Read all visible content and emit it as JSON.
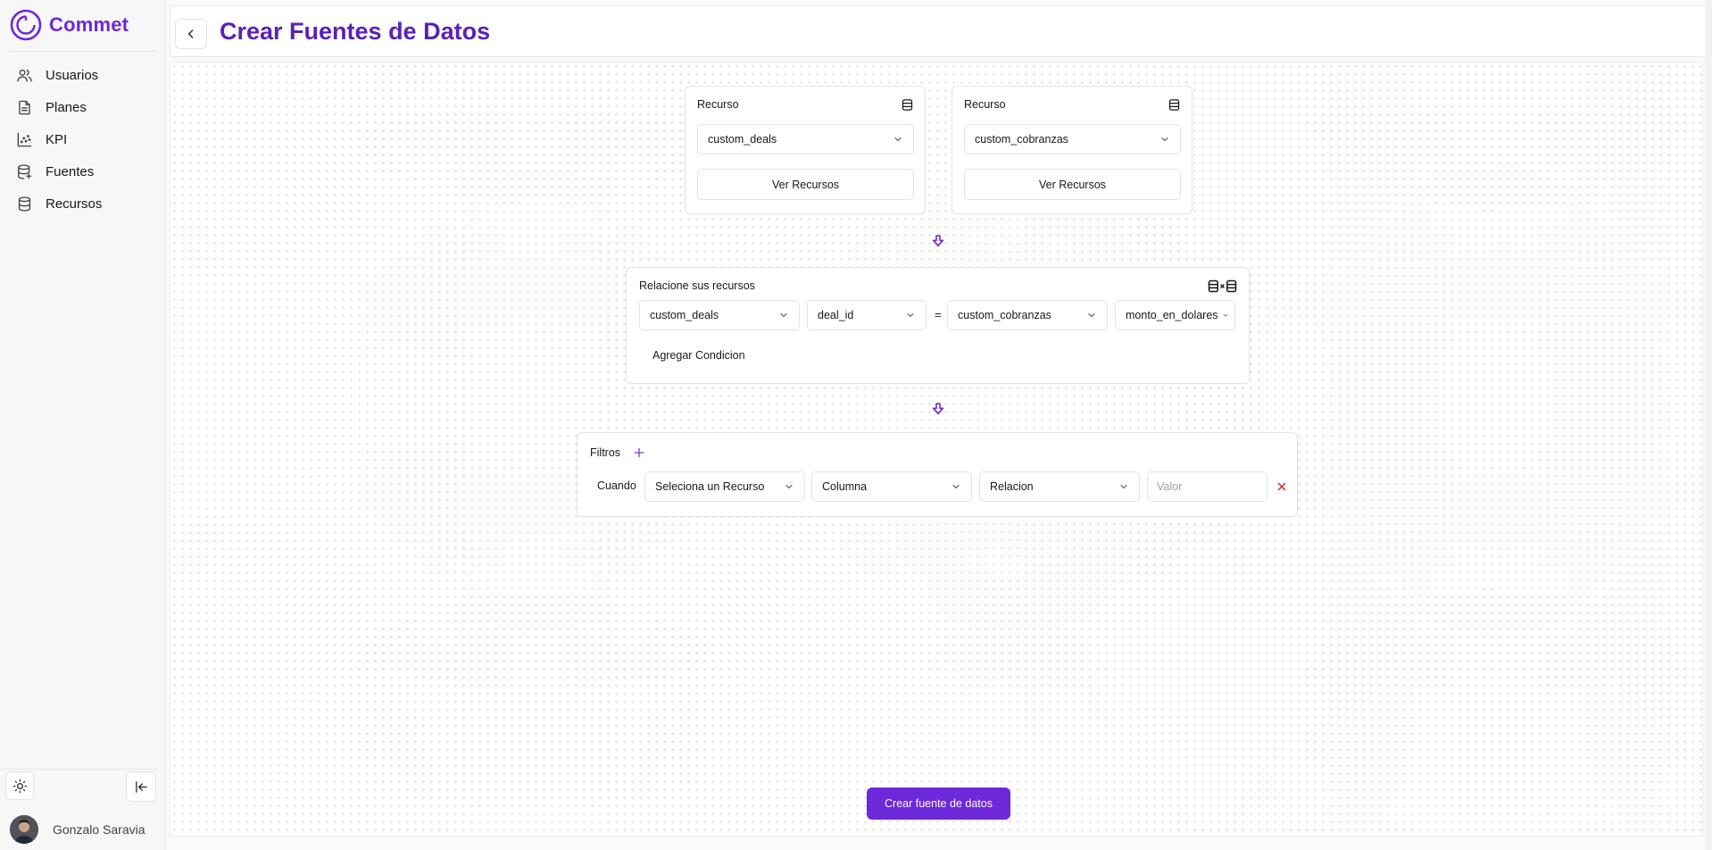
{
  "brand": {
    "name": "Commet",
    "accent": "#6d28d9"
  },
  "sidebar": {
    "items": [
      {
        "label": "Usuarios",
        "icon": "users-icon"
      },
      {
        "label": "Planes",
        "icon": "file-text-icon"
      },
      {
        "label": "KPI",
        "icon": "scatter-chart-icon"
      },
      {
        "label": "Fuentes",
        "icon": "database-plus-icon"
      },
      {
        "label": "Recursos",
        "icon": "database-icon"
      }
    ],
    "user": {
      "name": "Gonzalo Saravia"
    }
  },
  "header": {
    "title": "Crear Fuentes de Datos"
  },
  "resources": [
    {
      "title": "Recurso",
      "selected": "custom_deals",
      "button": "Ver Recursos"
    },
    {
      "title": "Recurso",
      "selected": "custom_cobranzas",
      "button": "Ver Recursos"
    }
  ],
  "relation": {
    "title": "Relacione sus recursos",
    "left_resource": "custom_deals",
    "left_column": "deal_id",
    "operator": "=",
    "right_resource": "custom_cobranzas",
    "right_column": "monto_en_dolares",
    "add_condition": "Agregar Condicion"
  },
  "filters": {
    "title": "Filtros",
    "when_label": "Cuando",
    "resource_placeholder": "Seleciona un Recurso",
    "column_placeholder": "Columna",
    "relation_placeholder": "Relacion",
    "value_placeholder": "Valor"
  },
  "submit": {
    "label": "Crear fuente de datos"
  }
}
